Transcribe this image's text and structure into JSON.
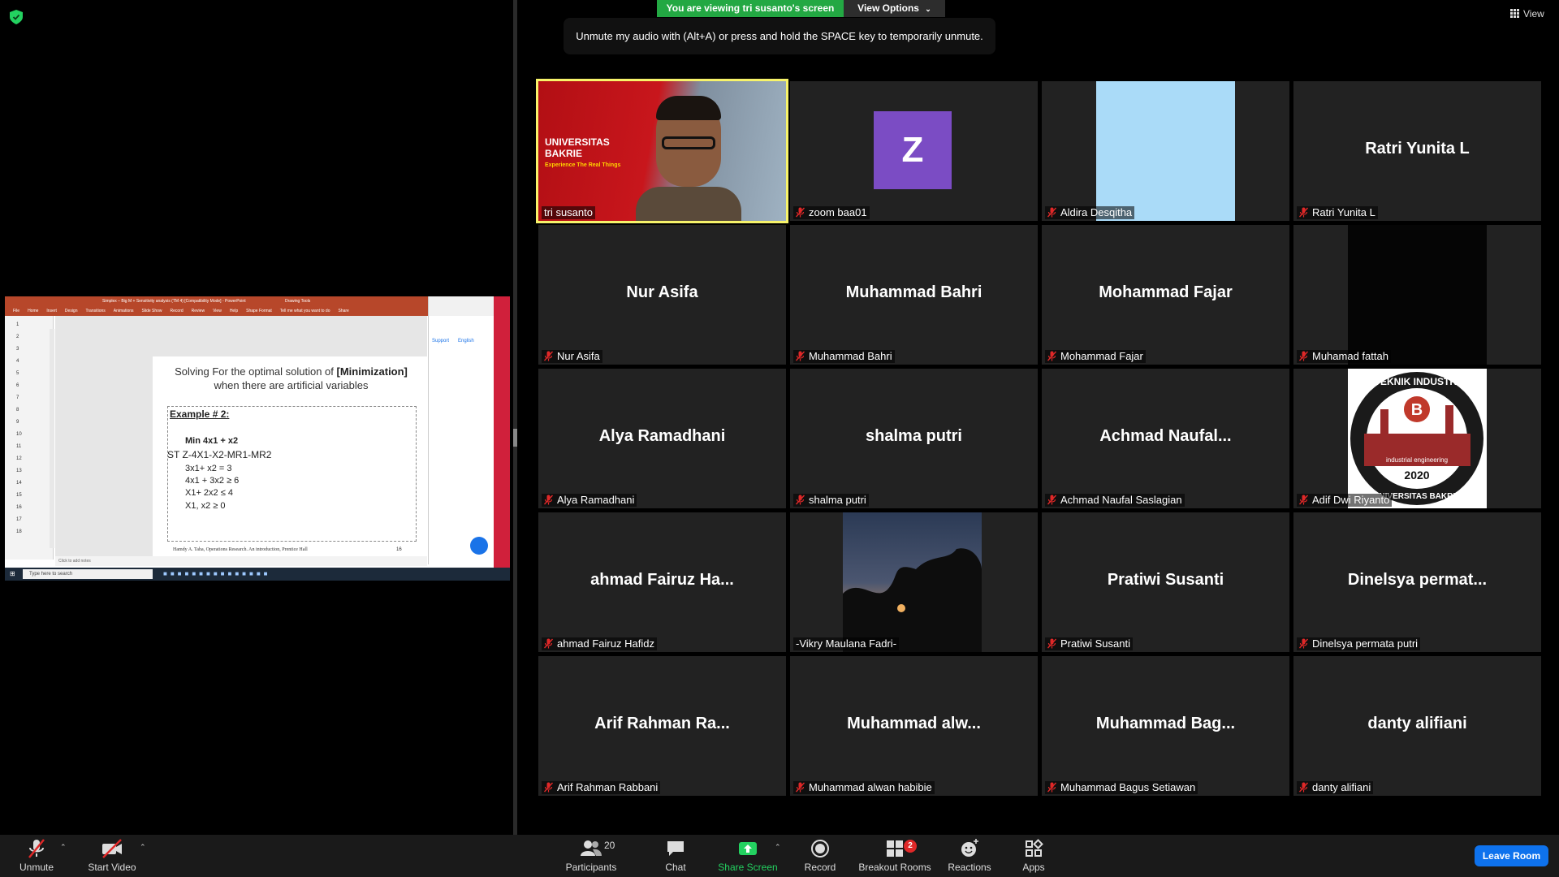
{
  "banner": {
    "viewing": "You are viewing tri susanto's screen",
    "view_options": "View Options",
    "toast": "Unmute my audio with (Alt+A) or press and hold the SPACE key to temporarily unmute.",
    "view": "View"
  },
  "shared_screen": {
    "window_title": "Simplex – Big M + Sensitivity analysis (TM 4) [Compatibility Mode] - PowerPoint",
    "drawing_tools": "Drawing Tools",
    "ribbon_tabs": [
      "File",
      "Home",
      "Insert",
      "Design",
      "Transitions",
      "Animations",
      "Slide Show",
      "Record",
      "Review",
      "View",
      "Help",
      "Shape Format",
      "Tell me what you want to do",
      "Share"
    ],
    "slide_numbers": [
      "1",
      "2",
      "3",
      "4",
      "5",
      "6",
      "7",
      "8",
      "9",
      "10",
      "11",
      "12",
      "13",
      "14",
      "15",
      "16",
      "17",
      "18"
    ],
    "slide": {
      "title_line1_prefix": "Solving For the optimal solution of ",
      "title_line1_bold": "[Minimization]",
      "title_line2": "when there are artificial variables",
      "example": "Example # 2:",
      "objective": "Min 4x1 + x2",
      "st": "ST      Z-4X1-X2-MR1-MR2",
      "c1": "3x1+ x2 = 3",
      "c2": "4x1 + 3x2 ≥ 6",
      "c3": "X1+ 2x2 ≤ 4",
      "c4": "X1, x2 ≥ 0",
      "reference": "Hamdy A. Taha, Operations Research. An introduction, Prentice Hall",
      "page": "16"
    },
    "notes_placeholder": "Click to add notes",
    "taskbar_search": "Type here to search",
    "browser_links": [
      "Support",
      "English"
    ]
  },
  "participants": [
    {
      "name": "tri susanto",
      "display": "",
      "type": "camera",
      "muted": false,
      "active": true
    },
    {
      "name": "zoom baa01",
      "display": "Z",
      "type": "avatar",
      "muted": true
    },
    {
      "name": "Aldira Desqitha",
      "display": "",
      "type": "lightblue",
      "muted": true
    },
    {
      "name": "Ratri Yunita L",
      "display": "Ratri Yunita L",
      "type": "name",
      "muted": true
    },
    {
      "name": "Nur Asifa",
      "display": "Nur Asifa",
      "type": "name",
      "muted": true
    },
    {
      "name": "Muhammad Bahri",
      "display": "Muhammad Bahri",
      "type": "name",
      "muted": true
    },
    {
      "name": "Mohammad Fajar",
      "display": "Mohammad Fajar",
      "type": "name",
      "muted": true
    },
    {
      "name": "Muhamad fattah",
      "display": "",
      "type": "dark",
      "muted": true
    },
    {
      "name": "Alya Ramadhani",
      "display": "Alya Ramadhani",
      "type": "name",
      "muted": true
    },
    {
      "name": "shalma putri",
      "display": "shalma putri",
      "type": "name",
      "muted": true
    },
    {
      "name": "Achmad Naufal Saslagian",
      "display": "Achmad  Naufal...",
      "type": "name",
      "muted": true
    },
    {
      "name": "Adif Dwi Riyanto",
      "display": "",
      "type": "logo",
      "muted": true
    },
    {
      "name": "ahmad Fairuz Hafidz",
      "display": "ahmad  Fairuz Ha...",
      "type": "name",
      "muted": true
    },
    {
      "name": "-Vikry Maulana Fadri-",
      "display": "",
      "type": "sunset",
      "muted": false
    },
    {
      "name": "Pratiwi Susanti",
      "display": "Pratiwi Susanti",
      "type": "name",
      "muted": true
    },
    {
      "name": "Dinelsya permata putri",
      "display": "Dinelsya  permat...",
      "type": "name",
      "muted": true
    },
    {
      "name": "Arif Rahman Rabbani",
      "display": "Arif  Rahman  Ra...",
      "type": "name",
      "muted": true
    },
    {
      "name": "Muhammad alwan habibie",
      "display": "Muhammad  alw...",
      "type": "name",
      "muted": true
    },
    {
      "name": "Muhammad Bagus Setiawan",
      "display": "Muhammad  Bag...",
      "type": "name",
      "muted": true
    },
    {
      "name": "danty alifiani",
      "display": "danty alifiani",
      "type": "name",
      "muted": true
    }
  ],
  "camera_overlay": {
    "uni_line1": "UNIVERSITAS",
    "uni_line2": "BAKRIE",
    "tagline": "Experience The Real Things"
  },
  "logo": {
    "top": "TEKNIK INDUSTRI",
    "middle": "industrial engineering",
    "year": "2020",
    "bottom": "UNIVERSITAS BAKRIE"
  },
  "toolbar": {
    "unmute": "Unmute",
    "start_video": "Start Video",
    "participants": "Participants",
    "participants_count": "20",
    "chat": "Chat",
    "share_screen": "Share Screen",
    "record": "Record",
    "breakout_rooms": "Breakout Rooms",
    "breakout_badge": "2",
    "reactions": "Reactions",
    "apps": "Apps",
    "leave_room": "Leave Room"
  },
  "colors": {
    "active_speaker": "#f7f36a",
    "banner_green": "#23a843",
    "leave_blue": "#0e72ed",
    "muted_red": "#e02828",
    "tile_bg": "#222222"
  }
}
